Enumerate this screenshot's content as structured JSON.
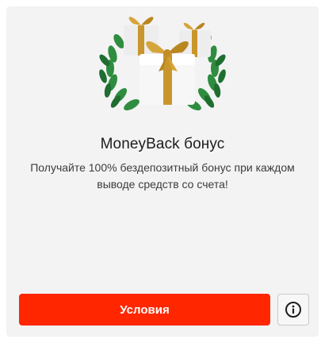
{
  "bonus_card": {
    "title": "MoneyBack бонус",
    "description": "Получайте 100% бездепозитный бонус при каждом выводе средств со счета!",
    "terms_button_label": "Условия",
    "colors": {
      "accent": "#ff2600",
      "card_background": "#f3f3f4",
      "gift_box": "#f4f4f4",
      "ribbon": "#c9962c",
      "leaves": "#2d8a3e"
    },
    "illustration_icon": "gift-boxes-laurel-wreath-icon",
    "info_icon": "info-circle-icon"
  }
}
